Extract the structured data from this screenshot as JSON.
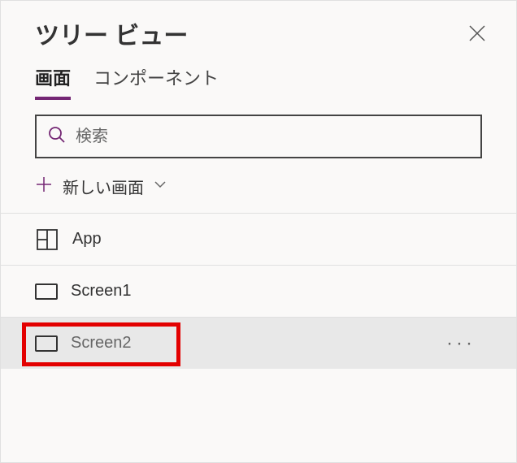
{
  "header": {
    "title": "ツリー ビュー"
  },
  "tabs": {
    "screens": "画面",
    "components": "コンポーネント"
  },
  "search": {
    "placeholder": "検索"
  },
  "newScreen": {
    "label": "新しい画面"
  },
  "tree": {
    "app": "App",
    "items": [
      {
        "label": "Screen1"
      },
      {
        "label": "Screen2"
      }
    ]
  }
}
